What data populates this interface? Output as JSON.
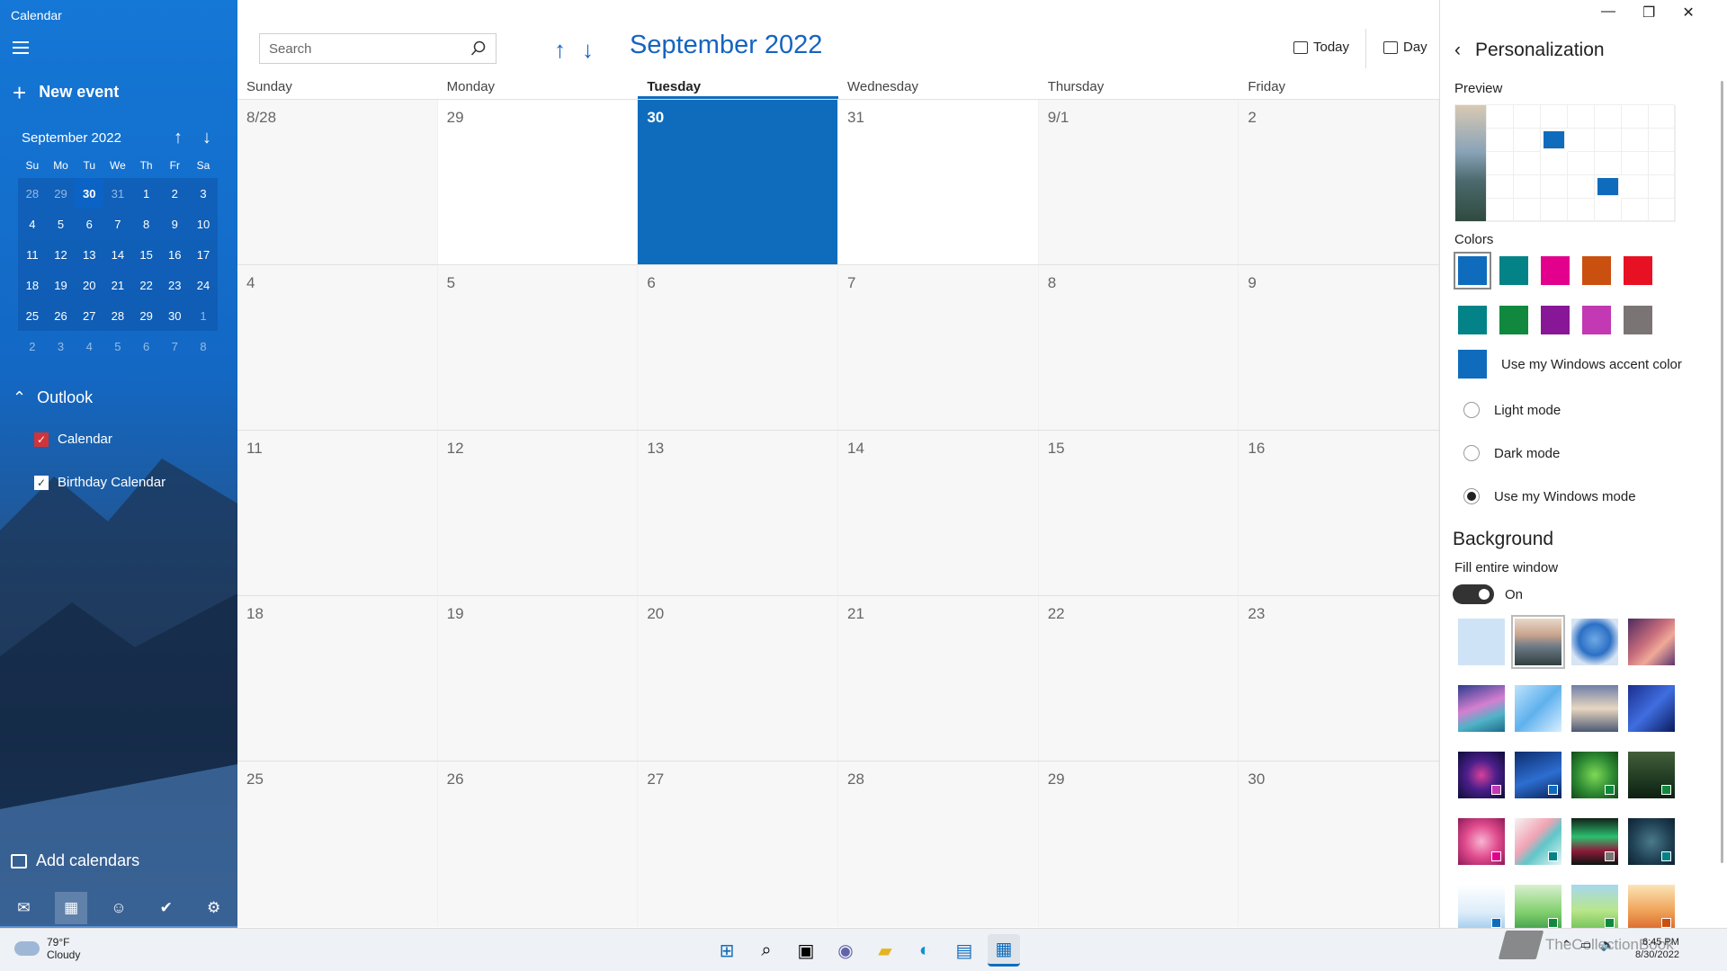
{
  "app": {
    "title": "Calendar"
  },
  "sidebar": {
    "new_event": "New event",
    "mini_month": "September 2022",
    "dow": [
      "Su",
      "Mo",
      "Tu",
      "We",
      "Th",
      "Fr",
      "Sa"
    ],
    "weeks": [
      [
        "28",
        "29",
        "30",
        "31",
        "1",
        "2",
        "3"
      ],
      [
        "4",
        "5",
        "6",
        "7",
        "8",
        "9",
        "10"
      ],
      [
        "11",
        "12",
        "13",
        "14",
        "15",
        "16",
        "17"
      ],
      [
        "18",
        "19",
        "20",
        "21",
        "22",
        "23",
        "24"
      ],
      [
        "25",
        "26",
        "27",
        "28",
        "29",
        "30",
        "1"
      ],
      [
        "2",
        "3",
        "4",
        "5",
        "6",
        "7",
        "8"
      ]
    ],
    "outlook_label": "Outlook",
    "calendars": [
      {
        "label": "Calendar",
        "color": "#d13438"
      },
      {
        "label": "Birthday Calendar",
        "color": "#ffffff"
      }
    ],
    "add_calendars": "Add calendars",
    "nav_icons": [
      "mail-icon",
      "calendar-icon",
      "people-icon",
      "todo-icon",
      "settings-icon"
    ]
  },
  "toolbar": {
    "search_placeholder": "Search",
    "month_title": "September 2022",
    "today_label": "Today",
    "day_label": "Day"
  },
  "grid": {
    "days_of_week": [
      "Sunday",
      "Monday",
      "Tuesday",
      "Wednesday",
      "Thursday",
      "Friday"
    ],
    "active_day_index": 2,
    "weeks": [
      [
        "8/28",
        "29",
        "30",
        "31",
        "9/1",
        "2"
      ],
      [
        "4",
        "5",
        "6",
        "7",
        "8",
        "9"
      ],
      [
        "11",
        "12",
        "13",
        "14",
        "15",
        "16"
      ],
      [
        "18",
        "19",
        "20",
        "21",
        "22",
        "23"
      ],
      [
        "25",
        "26",
        "27",
        "28",
        "29",
        "30"
      ]
    ]
  },
  "panel": {
    "title": "Personalization",
    "preview_label": "Preview",
    "colors_label": "Colors",
    "colors_row1": [
      "#0f6cbd",
      "#038387",
      "#e3008c",
      "#ca5010",
      "#e81123"
    ],
    "colors_row2": [
      "#038387",
      "#10893e",
      "#881798",
      "#c239b3",
      "#7a7574"
    ],
    "accent_label": "Use my Windows accent color",
    "accent_color": "#0f6cbd",
    "light_mode": "Light mode",
    "dark_mode": "Dark mode",
    "windows_mode": "Use my Windows mode",
    "background_title": "Background",
    "fill_label": "Fill entire window",
    "toggle_state": "On"
  },
  "taskbar": {
    "temperature": "79°F",
    "condition": "Cloudy",
    "time": "6:45 PM",
    "date": "8/30/2022",
    "watermark": "TheCollectionBook"
  }
}
